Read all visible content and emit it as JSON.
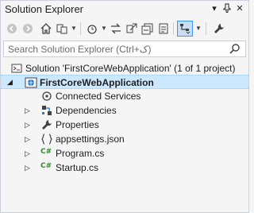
{
  "panel": {
    "title": "Solution Explorer",
    "pin_glyph": "▾",
    "autohide_glyph": "📌",
    "close_glyph": "✕"
  },
  "search": {
    "placeholder": "Search Solution Explorer (Ctrl+ک)"
  },
  "tree": {
    "solution": "Solution 'FirstCoreWebApplication' (1 of 1 project)",
    "project": "FirstCoreWebApplication",
    "items": [
      {
        "label": "Connected Services",
        "icon": "connected-services-icon"
      },
      {
        "label": "Dependencies",
        "icon": "dependencies-icon"
      },
      {
        "label": "Properties",
        "icon": "wrench-icon"
      },
      {
        "label": "appsettings.json",
        "icon": "json-file-icon"
      },
      {
        "label": "Program.cs",
        "icon": "csharp-file-icon"
      },
      {
        "label": "Startup.cs",
        "icon": "csharp-file-icon"
      }
    ],
    "csharp_badge": "C#"
  },
  "colors": {
    "accent": "#3399ff",
    "selection": "#cce8ff",
    "csharp": "#388a34"
  }
}
